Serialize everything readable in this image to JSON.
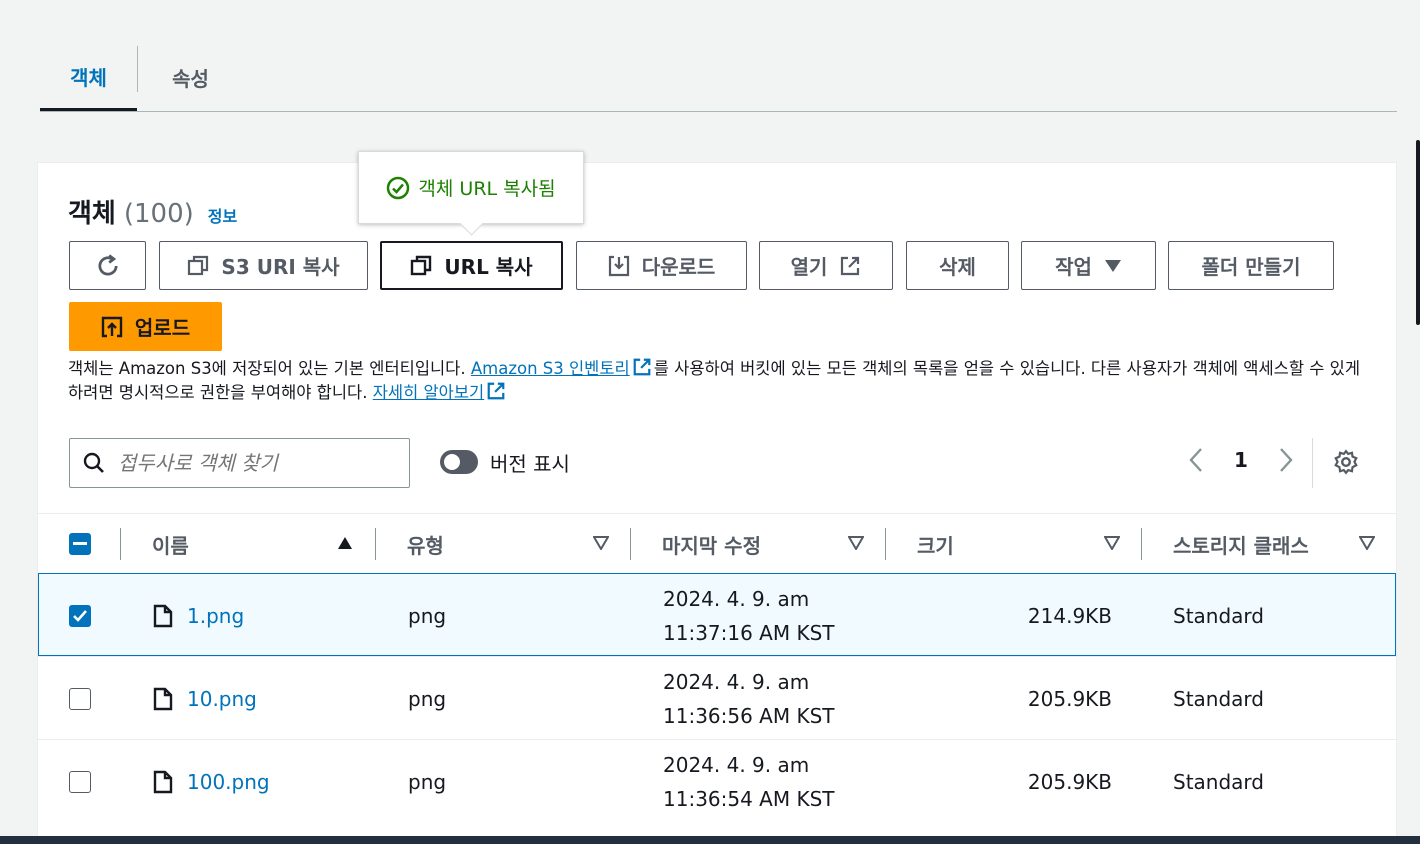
{
  "tabs": [
    {
      "label": "객체",
      "active": true
    },
    {
      "label": "속성",
      "active": false
    }
  ],
  "tooltip": {
    "text": "객체 URL 복사됨",
    "icon": "check-circle-icon"
  },
  "panel": {
    "title": "객체",
    "count": "(100)",
    "info_link": "정보"
  },
  "toolbar": {
    "refresh_icon": "refresh-icon",
    "copy_s3_uri": "S3 URI 복사",
    "copy_url": "URL 복사",
    "download": "다운로드",
    "open": "열기",
    "delete": "삭제",
    "actions": "작업",
    "create_folder": "폴더 만들기",
    "upload": "업로드"
  },
  "description": {
    "part1": "객체는 Amazon S3에 저장되어 있는 기본 엔터티입니다. ",
    "link1": "Amazon S3 인벤토리",
    "part2": "를 사용하여 버킷에 있는 모든 객체의 목록을 얻을 수 있습니다. 다른 사용자가 객체에 액세스할 수 있게 하려면 명시적으로 권한을 부여해야 합니다. ",
    "link2": "자세히 알아보기"
  },
  "search": {
    "placeholder": "접두사로 객체 찾기",
    "value": ""
  },
  "version_toggle": {
    "label": "버전 표시",
    "on": false
  },
  "pagination": {
    "current_page": "1"
  },
  "table": {
    "columns": [
      "이름",
      "유형",
      "마지막 수정",
      "크기",
      "스토리지 클래스"
    ],
    "rows": [
      {
        "name": "1.png",
        "type": "png",
        "modified_date": "2024. 4. 9. am",
        "modified_time": "11:37:16 AM KST",
        "size": "214.9KB",
        "storage": "Standard",
        "selected": true
      },
      {
        "name": "10.png",
        "type": "png",
        "modified_date": "2024. 4. 9. am",
        "modified_time": "11:36:56 AM KST",
        "size": "205.9KB",
        "storage": "Standard",
        "selected": false
      },
      {
        "name": "100.png",
        "type": "png",
        "modified_date": "2024. 4. 9. am",
        "modified_time": "11:36:54 AM KST",
        "size": "205.9KB",
        "storage": "Standard",
        "selected": false
      }
    ]
  },
  "colors": {
    "accent": "#0073bb",
    "upload": "#ff9900",
    "success": "#1d8102"
  }
}
